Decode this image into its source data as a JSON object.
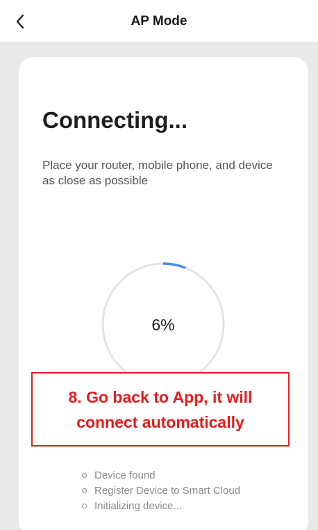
{
  "header": {
    "title": "AP Mode",
    "back_icon": "chevron-left-icon"
  },
  "card": {
    "heading": "Connecting...",
    "subtitle": "Place your router, mobile phone, and device as close as possible"
  },
  "progress": {
    "value": 6,
    "label": "6%",
    "color": "#4a8cf7",
    "track_color": "#e3e3e3"
  },
  "annotation": {
    "line1": "8. Go back to App, it will",
    "line2": "connect automatically",
    "color": "#e81b1b"
  },
  "steps": [
    {
      "label": "Device found"
    },
    {
      "label": "Register Device to Smart Cloud"
    },
    {
      "label": "Initializing device..."
    }
  ]
}
